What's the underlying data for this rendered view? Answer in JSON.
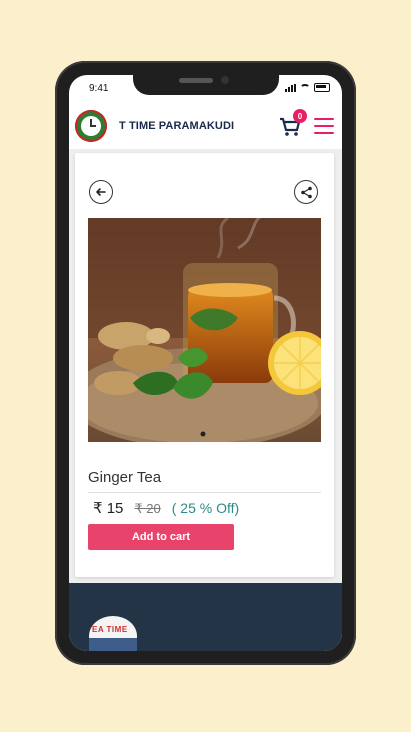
{
  "status": {
    "time": "9:41"
  },
  "header": {
    "brand": "T TIME PARAMAKUDI",
    "cart_count": "0"
  },
  "product": {
    "name": "Ginger Tea",
    "price": "₹ 15",
    "mrp": "₹ 20",
    "discount": "( 25 % Off)",
    "add_to_cart_label": "Add to cart"
  },
  "footer": {
    "logo_text": "EA TIME"
  },
  "colors": {
    "accent": "#e8436b",
    "brand_navy": "#1a2a4a",
    "footer_bg": "#243447",
    "discount": "#2a8a8a"
  },
  "icons": [
    "back-arrow-icon",
    "share-icon",
    "cart-icon",
    "hamburger-menu-icon"
  ]
}
